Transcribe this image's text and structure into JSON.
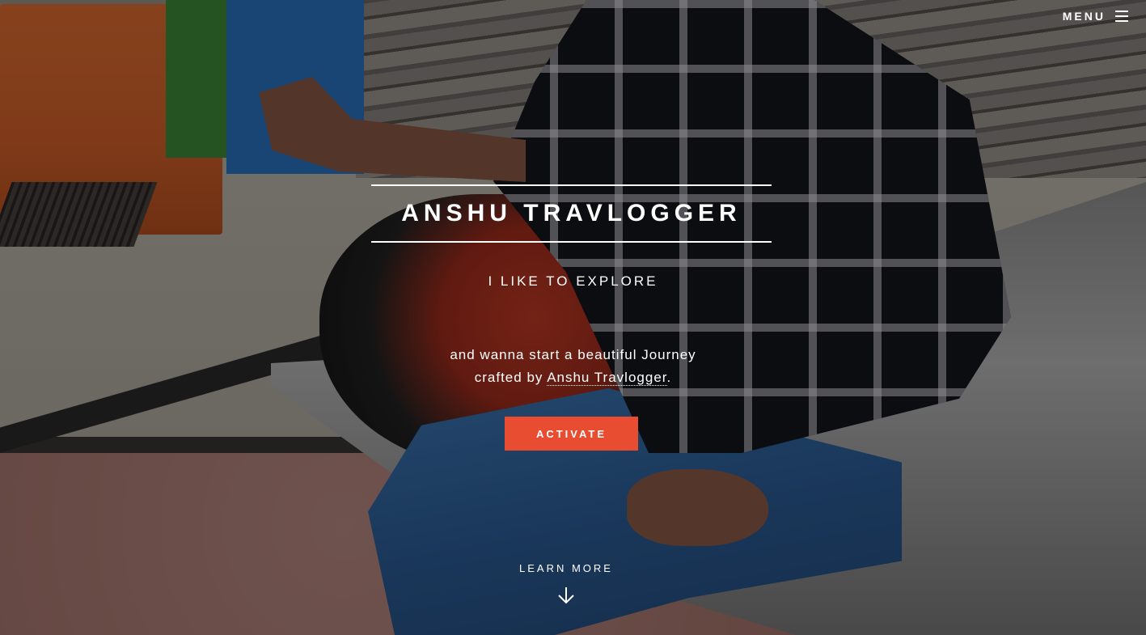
{
  "header": {
    "menu_label": "MENU",
    "menu_icon": "hamburger-icon"
  },
  "hero": {
    "title": "ANSHU TRAVLOGGER",
    "tagline": "I LIKE TO EXPLORE",
    "description_line1": "and wanna start a beautiful Journey",
    "description_prefix": "crafted by ",
    "description_link": "Anshu Travlogger",
    "description_suffix": ".",
    "activate_button": "ACTIVATE",
    "learn_more": "LEARN MORE",
    "learn_more_icon": "arrow-down-icon"
  },
  "colors": {
    "accent": "#e84c31",
    "text": "#ffffff"
  }
}
